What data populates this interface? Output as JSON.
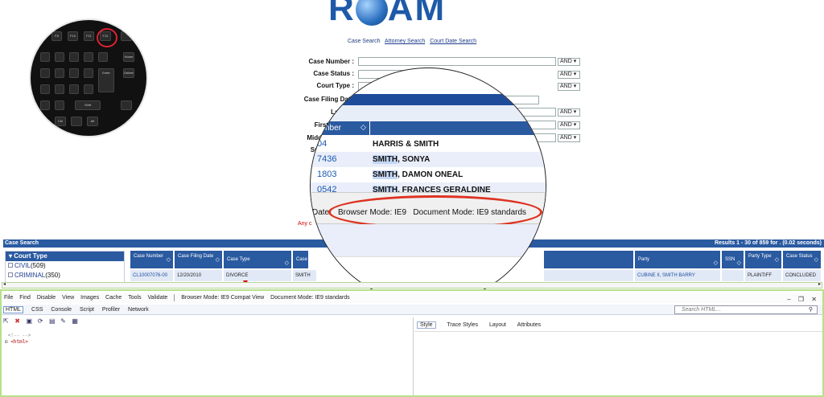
{
  "logo": {
    "text_left": "R",
    "text_right": "AM"
  },
  "search_links": [
    {
      "label": "Case Search",
      "active": true
    },
    {
      "label": "Attorney Search",
      "active": false
    },
    {
      "label": "Court Date Search",
      "active": false
    }
  ],
  "form": {
    "case_number": "Case Number :",
    "case_status": "Case Status :",
    "court_type": "Court Type :",
    "case_filing_date": "Case Filing Date",
    "last_name": "Last Na",
    "first_name": "First",
    "middle_name": "Midd",
    "suffix": "Su",
    "and_select": "AND",
    "warning": "Any c"
  },
  "keyboard": {
    "keys": [
      "F8",
      "F10",
      "F11",
      "F12",
      "Delete",
      "Home",
      "Enter",
      "Shift",
      "Ctrl",
      "Alt"
    ]
  },
  "results": {
    "title": "Case Search",
    "summary": "Results 1 - 30 of 859 for . (0.02 seconds)"
  },
  "facet": {
    "header": "Court Type",
    "items": [
      {
        "label": "CIVIL",
        "count": "(509)"
      },
      {
        "label": "CRIMINAL",
        "count": "(350)"
      }
    ]
  },
  "grid": {
    "columns": [
      "Case Number",
      "Case Filing Date",
      "Case Type",
      "Case Style",
      "Party",
      "SSN",
      "Party Type",
      "Case Status"
    ],
    "row": {
      "case_number": "CL10007076-00",
      "filing_date": "12/20/2010",
      "case_type": "DIVORCE",
      "case_style": "SMITH BARRY CUBINE I",
      "party": "CUBINE II, SMITH BARRY",
      "party_type": "PLAINTIFF",
      "case_status": "CONCLUDED"
    }
  },
  "magnifier": {
    "column_label": "nber",
    "rows": [
      {
        "num": "04",
        "name_hl": "",
        "name": "HARRIS & SMITH"
      },
      {
        "num": "7436",
        "name_hl": "SMITH",
        "name": ", SONYA"
      },
      {
        "num": "1803",
        "name_hl": "SMITH",
        "name": ", DAMON ONEAL"
      },
      {
        "num": "0542",
        "name_hl": "SMITH",
        "name": ", FRANCES GERALDINE"
      }
    ],
    "date_label": "Date",
    "browser_mode": "Browser Mode: IE9",
    "document_mode": "Document Mode: IE9 standards"
  },
  "devtools": {
    "menu": [
      "File",
      "Find",
      "Disable",
      "View",
      "Images",
      "Cache",
      "Tools",
      "Validate"
    ],
    "browser_mode": "Browser Mode: IE9 Compat View",
    "document_mode": "Document Mode: IE9 standards",
    "tabs": [
      "HTML",
      "CSS",
      "Console",
      "Script",
      "Profiler",
      "Network"
    ],
    "search_placeholder": "Search HTML...",
    "code_line1": "<!--      -->",
    "code_line2": "<html>",
    "right_tabs": [
      "Style",
      "Trace Styles",
      "Layout",
      "Attributes"
    ]
  }
}
